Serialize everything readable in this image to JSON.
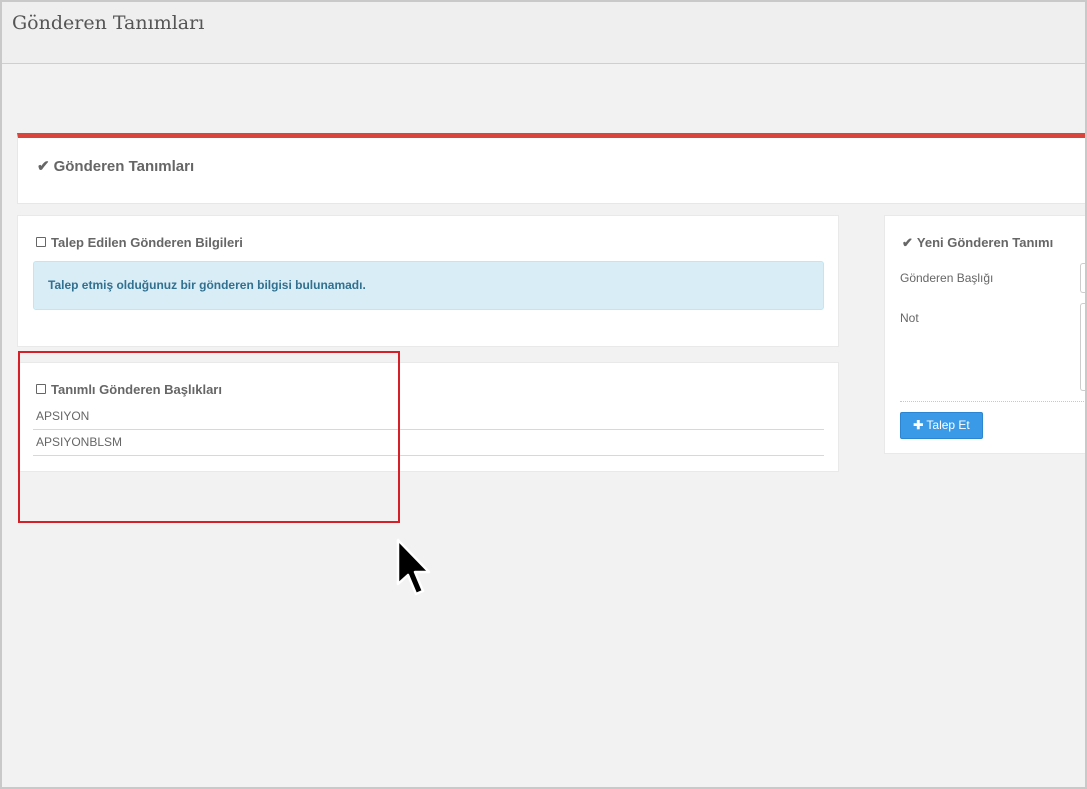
{
  "page": {
    "title": "Gönderen Tanımları"
  },
  "portlet": {
    "title": "Gönderen Tanımları"
  },
  "requested": {
    "title": "Talep Edilen Gönderen Bilgileri",
    "alert": "Talep etmiş olduğunuz bir gönderen bilgisi bulunamadı."
  },
  "defined": {
    "title": "Tanımlı Gönderen Başlıkları",
    "items": [
      "APSIYON",
      "APSIYONBLSM"
    ]
  },
  "new_sender": {
    "title": "Yeni Gönderen Tanımı",
    "header_label": "Gönderen Başlığı",
    "note_label": "Not",
    "submit_label": "Talep Et"
  },
  "colors": {
    "accent": "#d9453d",
    "button": "#3a9ae8",
    "alert_bg": "#d9edf7",
    "highlight": "#d62027"
  },
  "icons": {
    "check": "check-icon",
    "checkbox": "checked-box-icon",
    "plus": "plus-icon",
    "cursor": "mouse-pointer-icon"
  }
}
